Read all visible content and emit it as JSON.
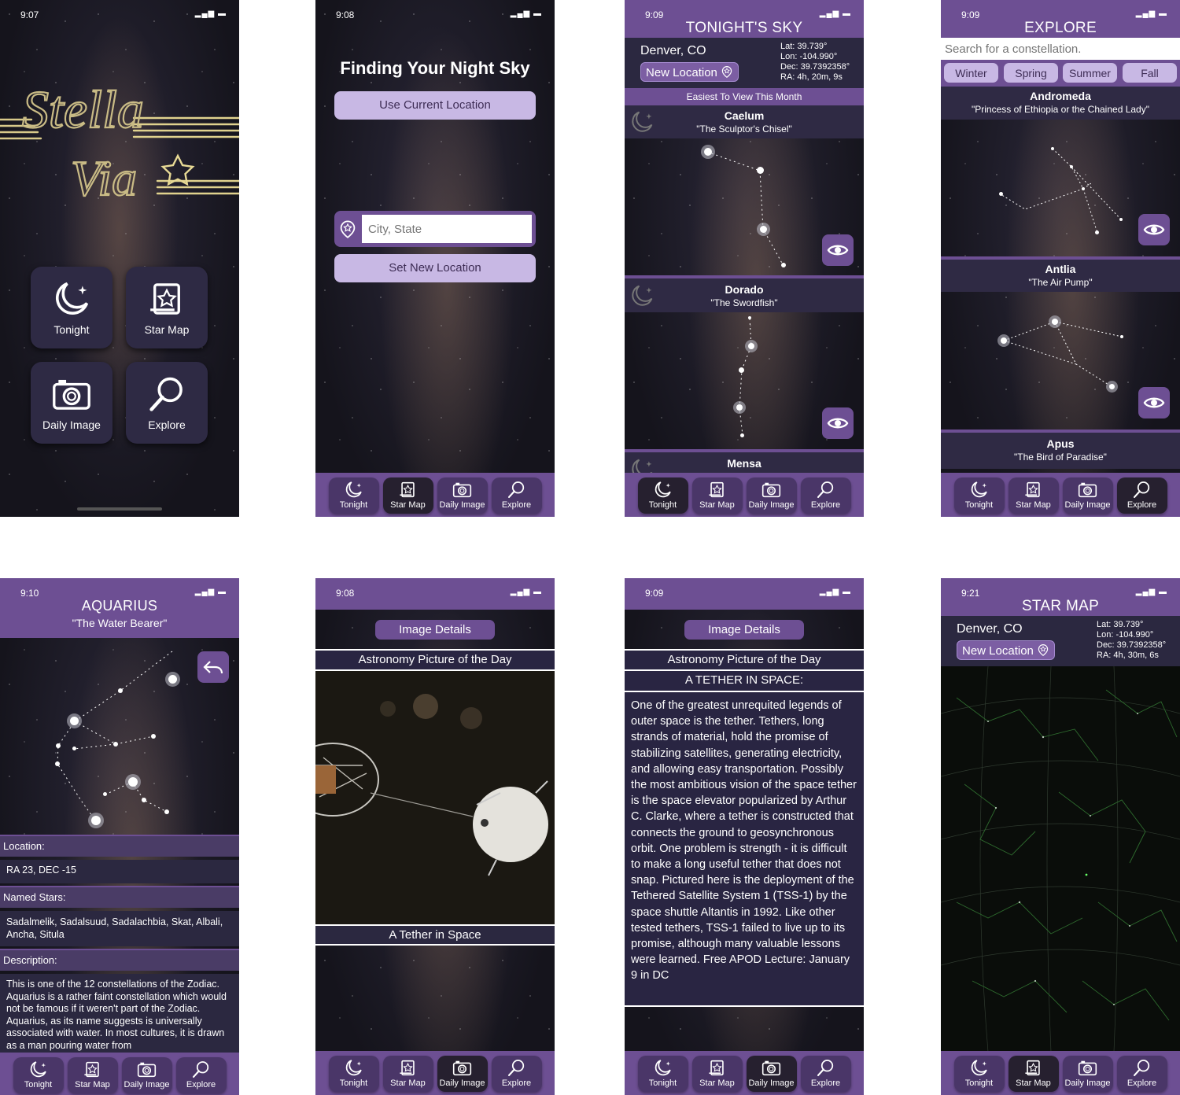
{
  "colors": {
    "accent": "#6d4f93",
    "button": "#c8b8e4",
    "dark_tile": "#2e2a44"
  },
  "tabs": {
    "tonight": "Tonight",
    "starmap": "Star Map",
    "daily": "Daily Image",
    "explore": "Explore"
  },
  "s1": {
    "time": "9:07",
    "logo_line1": "Stella",
    "logo_line2": "Via",
    "tiles": {
      "tonight": "Tonight",
      "starmap": "Star Map",
      "daily": "Daily Image",
      "explore": "Explore"
    }
  },
  "s2": {
    "time": "9:08",
    "title": "Finding Your Night Sky",
    "use_current": "Use Current Location",
    "city_placeholder": "City, State",
    "set_new": "Set New Location"
  },
  "s3": {
    "time": "9:09",
    "title": "TONIGHT'S SKY",
    "city": "Denver, CO",
    "new_location": "New Location",
    "lat": "Lat: 39.739°",
    "lon": "Lon: -104.990°",
    "dec": "Dec: 39.7392358°",
    "ra": "RA: 4h, 20m, 9s",
    "easiest": "Easiest To View This Month",
    "constellations": [
      {
        "name": "Caelum",
        "nick": "\"The Sculptor's Chisel\""
      },
      {
        "name": "Dorado",
        "nick": "\"The Swordfish\""
      },
      {
        "name": "Mensa",
        "nick": ""
      }
    ]
  },
  "s4": {
    "time": "9:09",
    "title": "EXPLORE",
    "search_placeholder": "Search for a constellation.",
    "seasons": [
      "Winter",
      "Spring",
      "Summer",
      "Fall"
    ],
    "constellations": [
      {
        "name": "Andromeda",
        "nick": "\"Princess of Ethiopia or the Chained Lady\""
      },
      {
        "name": "Antlia",
        "nick": "\"The Air Pump\""
      },
      {
        "name": "Apus",
        "nick": "\"The Bird of Paradise\""
      }
    ]
  },
  "s5": {
    "time": "9:10",
    "title": "AQUARIUS",
    "nick": "\"The Water Bearer\"",
    "location_label": "Location:",
    "location_value": "RA 23, DEC -15",
    "named_label": "Named Stars:",
    "named_value": "Sadalmelik, Sadalsuud, Sadalachbia, Skat, Albali, Ancha, Situla",
    "desc_label": "Description:",
    "desc_value": "This is one of the 12 constellations of the Zodiac. Aquarius is a rather faint constellation which would not be famous if it weren't part of the Zodiac. Aquarius, as its name suggests is universally associated with water. In most cultures, it is drawn as a man pouring water from"
  },
  "s6": {
    "time": "9:08",
    "details_btn": "Image Details",
    "apod": "Astronomy Picture of the Day",
    "caption": "A Tether in Space"
  },
  "s7": {
    "time": "9:09",
    "details_btn": "Image Details",
    "apod": "Astronomy Picture of the Day",
    "heading": "A TETHER IN SPACE:",
    "body": "One of the greatest unrequited legends of outer space is the tether.  Tethers, long strands of material, hold the promise of stabilizing satellites, generating electricity, and allowing easy transportation.  Possibly the most ambitious vision of the space tether is the space elevator popularized by Arthur C. Clarke, where a tether is constructed that connects the ground to geosynchronous orbit.  One problem is strength - it is difficult to make a long useful tether that does not snap.  Pictured here is the deployment of the Tethered Satellite System 1 (TSS-1) by the space shuttle Altantis in 1992.  Like other tested tethers, TSS-1 failed to live up to its promise, although many valuable lessons were learned.   Free APOD Lecture: January 9 in DC"
  },
  "s8": {
    "time": "9:21",
    "title": "STAR MAP",
    "city": "Denver, CO",
    "new_location": "New Location",
    "lat": "Lat: 39.739°",
    "lon": "Lon: -104.990°",
    "dec": "Dec: 39.7392358°",
    "ra": "RA: 4h, 30m, 6s"
  }
}
